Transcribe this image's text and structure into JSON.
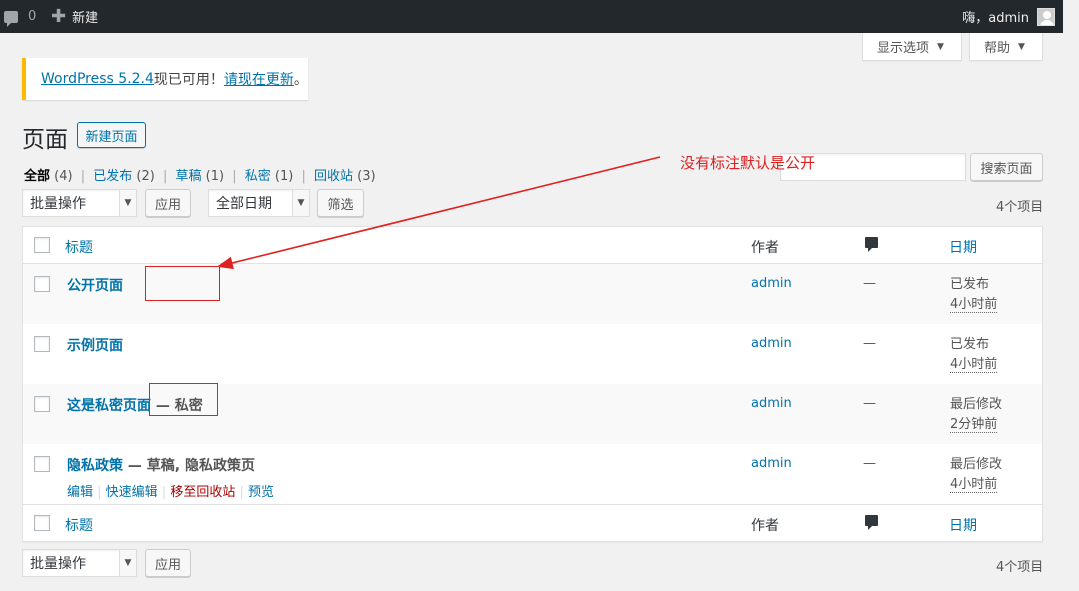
{
  "adminbar": {
    "comments_count": "0",
    "new_label": "新建",
    "greeting": "嗨，admin"
  },
  "screen_options": {
    "label": "显示选项"
  },
  "help": {
    "label": "帮助"
  },
  "notice": {
    "version_link": "WordPress 5.2.4",
    "middle_text": "现已可用！",
    "update_link": "请现在更新",
    "end": "。"
  },
  "page": {
    "title": "页面",
    "add_new": "新建页面"
  },
  "filters": [
    {
      "label": "全部",
      "count": "(4)",
      "current": true
    },
    {
      "label": "已发布",
      "count": "(2)"
    },
    {
      "label": "草稿",
      "count": "(1)"
    },
    {
      "label": "私密",
      "count": "(1)"
    },
    {
      "label": "回收站",
      "count": "(3)"
    }
  ],
  "search": {
    "value": "",
    "button": "搜索页面"
  },
  "bulk": {
    "selected": "批量操作",
    "apply": "应用"
  },
  "date_filter": {
    "selected": "全部日期",
    "button": "筛选"
  },
  "items_count": "4个项目",
  "table": {
    "headers": {
      "title": "标题",
      "author": "作者",
      "date": "日期"
    },
    "rows": [
      {
        "title": "公开页面",
        "state": "",
        "author": "admin",
        "comments": "—",
        "date_status": "已发布",
        "date_time": "4小时前"
      },
      {
        "title": "示例页面",
        "state": "",
        "author": "admin",
        "comments": "—",
        "date_status": "已发布",
        "date_time": "4小时前"
      },
      {
        "title": "这是私密页面",
        "state": " — 私密",
        "author": "admin",
        "comments": "—",
        "date_status": "最后修改",
        "date_time": "2分钟前"
      },
      {
        "title": "隐私政策",
        "state": " — 草稿, 隐私政策页",
        "author": "admin",
        "comments": "—",
        "date_status": "最后修改",
        "date_time": "4小时前",
        "actions": {
          "edit": "编辑",
          "quick_edit": "快速编辑",
          "trash": "移至回收站",
          "preview": "预览"
        }
      }
    ]
  },
  "annotation": {
    "text": "没有标注默认是公开",
    "color": "#e02020"
  },
  "colors": {
    "link": "#0073aa",
    "adminbar": "#23282d",
    "notice_border": "#ffb900",
    "trash": "#aa0000"
  }
}
